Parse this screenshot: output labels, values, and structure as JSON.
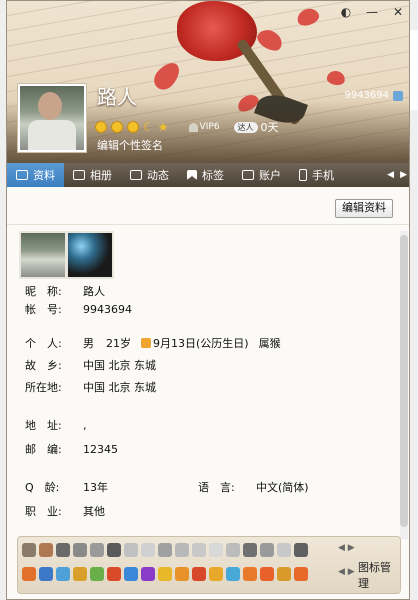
{
  "window": {
    "controls": [
      "◐",
      "—",
      "✕"
    ]
  },
  "profile": {
    "nickname": "路人",
    "qq_number": "9943694",
    "level_pill": "达人",
    "level_days": "0天",
    "vip_label": "VIP6",
    "signature": "编辑个性签名"
  },
  "tabs": [
    {
      "label": "资料",
      "active": true
    },
    {
      "label": "相册",
      "active": false
    },
    {
      "label": "动态",
      "active": false
    },
    {
      "label": "标签",
      "active": false
    },
    {
      "label": "账户",
      "active": false
    },
    {
      "label": "手机",
      "active": false
    }
  ],
  "edit_button": "编辑资料",
  "info": {
    "nickname_label": "昵　称:",
    "nickname_value": "路人",
    "account_label": "帐　号:",
    "account_value": "9943694",
    "personal_label": "个　人:",
    "gender": "男",
    "age": "21岁",
    "birthday": "9月13日(公历生日)",
    "zodiac": "属猴",
    "hometown_label": "故　乡:",
    "hometown_value": "中国 北京 东城",
    "location_label": "所在地:",
    "location_value": "中国 北京 东城",
    "address_label": "地　址:",
    "address_value": ",",
    "postcode_label": "邮　编:",
    "postcode_value": "12345",
    "qage_label": "Q　龄:",
    "qage_value": "13年",
    "language_label": "语　言:",
    "language_value": "中文(简体)",
    "job_label": "职　业:",
    "job_value": "其他"
  },
  "iconbar": {
    "manage_label": "图标管理",
    "row1_colors": [
      "#8a7a6a",
      "#b07850",
      "#6a6a6a",
      "#8a8a8a",
      "#9a9a9a",
      "#5a5a5a",
      "#c0c0c0",
      "#d0d0d0",
      "#a0a0a0",
      "#b8b8b8",
      "#c8c8c8",
      "#d8d8d8",
      "#bcbcbc",
      "#707070",
      "#9a9a9a",
      "#c8c8c8",
      "#606060"
    ],
    "row2_colors": [
      "#e2702a",
      "#3c78c8",
      "#4ea0d8",
      "#d8a02a",
      "#6ab04a",
      "#d84a2a",
      "#3c88d8",
      "#8a3cc8",
      "#e8b82a",
      "#e8902a",
      "#d8482a",
      "#e8a82a",
      "#48a8d8",
      "#e87a2a",
      "#e8602a",
      "#d89a2a",
      "#e8682a"
    ]
  }
}
